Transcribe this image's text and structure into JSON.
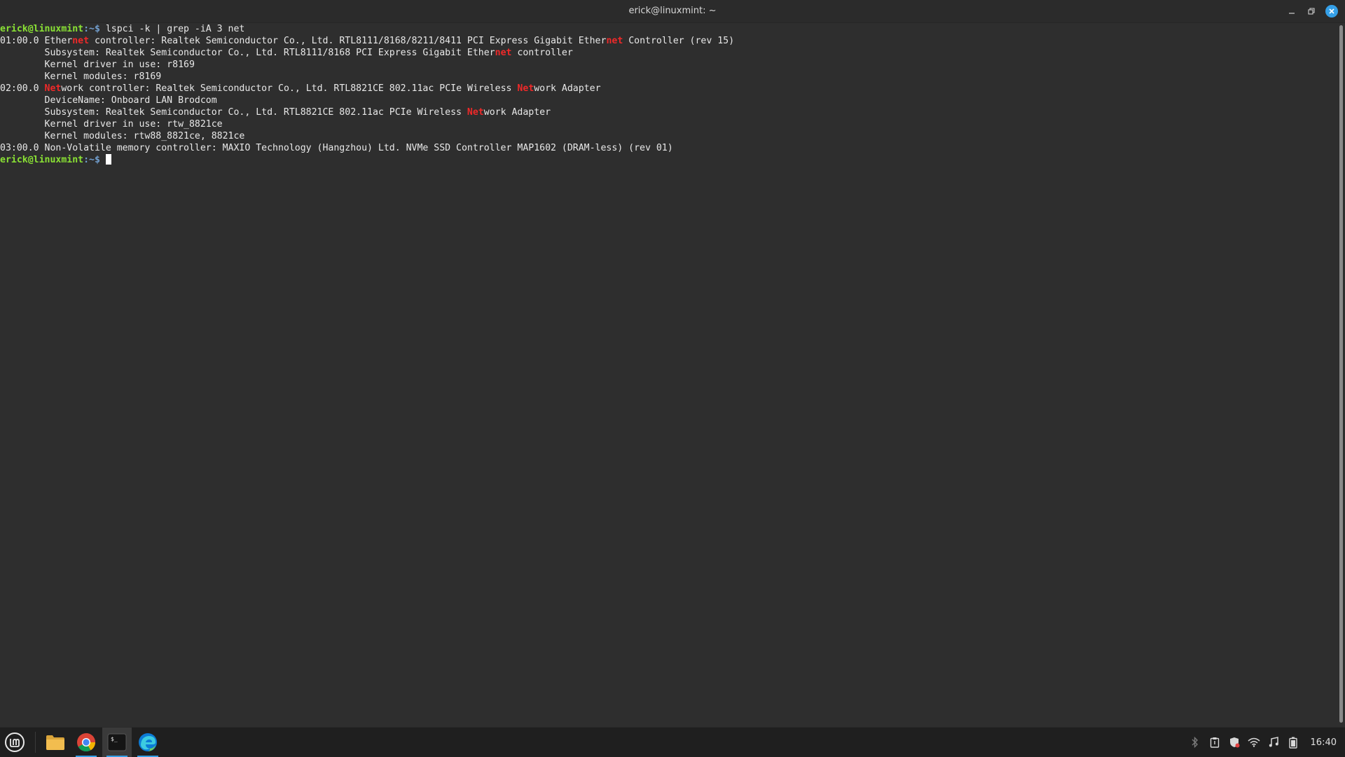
{
  "window": {
    "title": "erick@linuxmint: ~"
  },
  "terminal": {
    "prompt_user": "erick@linuxmint",
    "prompt_path": ":~$",
    "command": " lspci -k | grep -iA 3 net",
    "lines": {
      "l1": {
        "a": "01:00.0 Ether",
        "b": "net",
        "c": " controller: Realtek Semiconductor Co., Ltd. RTL8111/8168/8211/8411 PCI Express Gigabit Ether",
        "d": "net",
        "e": " Controller (rev 15)"
      },
      "l2": {
        "a": "        Subsystem: Realtek Semiconductor Co., Ltd. RTL8111/8168 PCI Express Gigabit Ether",
        "b": "net",
        "c": " controller"
      },
      "l3": "        Kernel driver in use: r8169",
      "l4": "        Kernel modules: r8169",
      "l5": {
        "a": "02:00.0 ",
        "b": "Net",
        "c": "work controller: Realtek Semiconductor Co., Ltd. RTL8821CE 802.11ac PCIe Wireless ",
        "d": "Net",
        "e": "work Adapter"
      },
      "l6": "        DeviceName: Onboard LAN Brodcom",
      "l7": {
        "a": "        Subsystem: Realtek Semiconductor Co., Ltd. RTL8821CE 802.11ac PCIe Wireless ",
        "b": "Net",
        "c": "work Adapter"
      },
      "l8": "        Kernel driver in use: rtw_8821ce",
      "l9": "        Kernel modules: rtw88_8821ce, 8821ce",
      "l10": "03:00.0 Non-Volatile memory controller: MAXIO Technology (Hangzhou) Ltd. NVMe SSD Controller MAP1602 (DRAM-less) (rev 01)"
    }
  },
  "taskbar": {
    "clock": "16:40",
    "apps": [
      "file-manager",
      "google-chrome",
      "terminal",
      "microsoft-edge"
    ],
    "tray_icons": [
      "bluetooth-icon",
      "clipboard-icon",
      "shield-icon",
      "wifi-icon",
      "music-icon",
      "battery-icon"
    ]
  },
  "colors": {
    "prompt_user": "#8ae234",
    "prompt_path": "#729fcf",
    "match_highlight": "#ef2929",
    "close_button": "#35a0e8"
  }
}
